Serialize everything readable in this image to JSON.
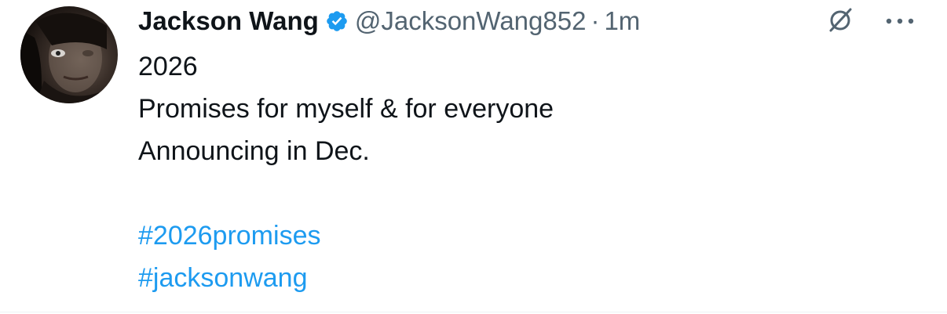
{
  "tweet": {
    "author": {
      "display_name": "Jackson Wang",
      "handle": "@JacksonWang852",
      "verified": true,
      "verified_icon": "verified-badge-icon",
      "verified_color": "#1d9bf0"
    },
    "separator": "·",
    "timestamp": "1m",
    "text_lines": [
      "2026",
      "Promises for myself & for everyone",
      "Announcing in Dec."
    ],
    "hashtags": [
      "#2026promises",
      "#jacksonwang"
    ],
    "actions": {
      "grok_icon": "grok-icon",
      "more_icon": "more-options-icon"
    },
    "colors": {
      "text": "#0f1419",
      "secondary": "#536471",
      "link": "#1d9bf0"
    }
  }
}
